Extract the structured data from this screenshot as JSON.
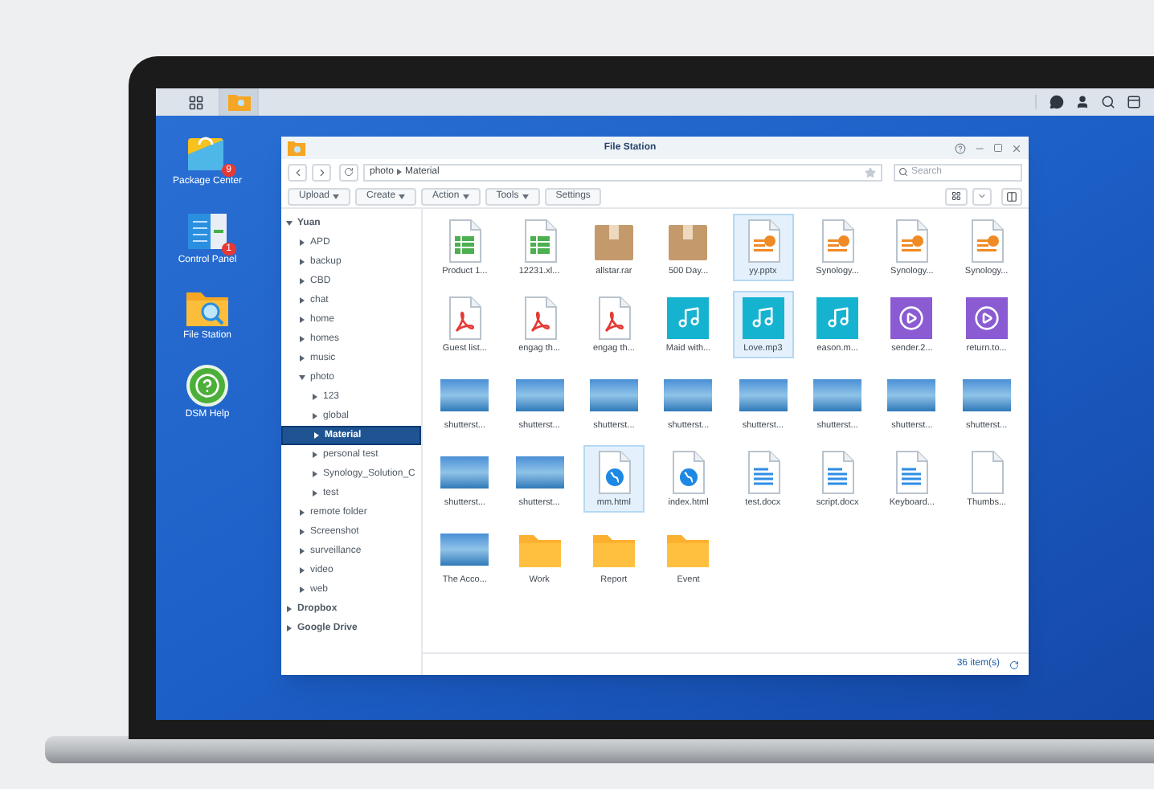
{
  "desktop_icons": [
    {
      "kind": "package",
      "label": "Package Center",
      "badge": "9"
    },
    {
      "kind": "control",
      "label": "Control Panel",
      "badge": "1"
    },
    {
      "kind": "files",
      "label": "File Station"
    },
    {
      "kind": "help",
      "label": "DSM Help"
    }
  ],
  "window": {
    "title": "File Station",
    "path": [
      "photo",
      "Material"
    ],
    "search": {
      "placeholder": "Search"
    },
    "toolbar": [
      {
        "label": "Upload",
        "dropdown": true
      },
      {
        "label": "Create",
        "dropdown": true
      },
      {
        "label": "Action",
        "dropdown": true
      },
      {
        "label": "Tools",
        "dropdown": true
      },
      {
        "label": "Settings",
        "dropdown": false
      }
    ],
    "tree": [
      {
        "label": "Yuan",
        "expanded": true,
        "selected": false,
        "children": [
          {
            "label": "APD",
            "expanded": false,
            "selected": false
          },
          {
            "label": "backup",
            "expanded": false,
            "selected": false
          },
          {
            "label": "CBD",
            "expanded": false,
            "selected": false
          },
          {
            "label": "chat",
            "expanded": false,
            "selected": false
          },
          {
            "label": "home",
            "expanded": false,
            "selected": false
          },
          {
            "label": "homes",
            "expanded": false,
            "selected": false
          },
          {
            "label": "music",
            "expanded": false,
            "selected": false
          },
          {
            "label": "photo",
            "expanded": true,
            "selected": false,
            "children": [
              {
                "label": "123",
                "expanded": false,
                "selected": false
              },
              {
                "label": "global",
                "expanded": false,
                "selected": false
              },
              {
                "label": "Material",
                "expanded": false,
                "selected": true
              },
              {
                "label": "personal test",
                "expanded": false,
                "selected": false
              },
              {
                "label": "Synology_Solution_C",
                "expanded": false,
                "selected": false
              },
              {
                "label": "test",
                "expanded": false,
                "selected": false
              }
            ]
          },
          {
            "label": "remote folder",
            "expanded": false,
            "selected": false
          },
          {
            "label": "Screenshot",
            "expanded": false,
            "selected": false
          },
          {
            "label": "surveillance",
            "expanded": false,
            "selected": false
          },
          {
            "label": "video",
            "expanded": false,
            "selected": false
          },
          {
            "label": "web",
            "expanded": false,
            "selected": false
          }
        ]
      },
      {
        "label": "Dropbox",
        "expanded": false,
        "selected": false
      },
      {
        "label": "Google Drive",
        "expanded": false,
        "selected": false
      }
    ],
    "files": [
      {
        "kind": "sheet",
        "name": "Product 1...",
        "selected": false
      },
      {
        "kind": "sheet",
        "name": "12231.xl...",
        "selected": false
      },
      {
        "kind": "archive",
        "name": "allstar.rar",
        "selected": false
      },
      {
        "kind": "archive",
        "name": "500 Day...",
        "selected": false
      },
      {
        "kind": "slides",
        "name": "yy.pptx",
        "selected": true
      },
      {
        "kind": "slides",
        "name": "Synology...",
        "selected": false
      },
      {
        "kind": "slides",
        "name": "Synology...",
        "selected": false
      },
      {
        "kind": "slides",
        "name": "Synology...",
        "selected": false
      },
      {
        "kind": "pdf",
        "name": "Guest list...",
        "selected": false
      },
      {
        "kind": "pdf",
        "name": "engag th...",
        "selected": false
      },
      {
        "kind": "pdf",
        "name": "engag th...",
        "selected": false
      },
      {
        "kind": "audio",
        "name": "Maid with...",
        "selected": false
      },
      {
        "kind": "audio",
        "name": "Love.mp3",
        "selected": true
      },
      {
        "kind": "audio",
        "name": "eason.m...",
        "selected": false
      },
      {
        "kind": "video",
        "name": "sender.2...",
        "selected": false
      },
      {
        "kind": "video",
        "name": "return.to...",
        "selected": false
      },
      {
        "kind": "photo",
        "name": "shutterst...",
        "selected": false
      },
      {
        "kind": "photo",
        "name": "shutterst...",
        "selected": false
      },
      {
        "kind": "photo",
        "name": "shutterst...",
        "selected": false
      },
      {
        "kind": "photo",
        "name": "shutterst...",
        "selected": false
      },
      {
        "kind": "photo",
        "name": "shutterst...",
        "selected": false
      },
      {
        "kind": "photo",
        "name": "shutterst...",
        "selected": false
      },
      {
        "kind": "photo",
        "name": "shutterst...",
        "selected": false
      },
      {
        "kind": "photo",
        "name": "shutterst...",
        "selected": false
      },
      {
        "kind": "photo",
        "name": "shutterst...",
        "selected": false
      },
      {
        "kind": "photo",
        "name": "shutterst...",
        "selected": false
      },
      {
        "kind": "web",
        "name": "mm.html",
        "selected": true
      },
      {
        "kind": "web",
        "name": "index.html",
        "selected": false
      },
      {
        "kind": "doc",
        "name": "test.docx",
        "selected": false
      },
      {
        "kind": "doc",
        "name": "script.docx",
        "selected": false
      },
      {
        "kind": "doc",
        "name": "Keyboard...",
        "selected": false
      },
      {
        "kind": "blank",
        "name": "Thumbs...",
        "selected": false
      },
      {
        "kind": "photo",
        "name": "The Acco...",
        "selected": false
      },
      {
        "kind": "folder",
        "name": "Work",
        "selected": false
      },
      {
        "kind": "folder",
        "name": "Report",
        "selected": false
      },
      {
        "kind": "folder",
        "name": "Event",
        "selected": false
      }
    ],
    "status": "36 item(s)"
  }
}
